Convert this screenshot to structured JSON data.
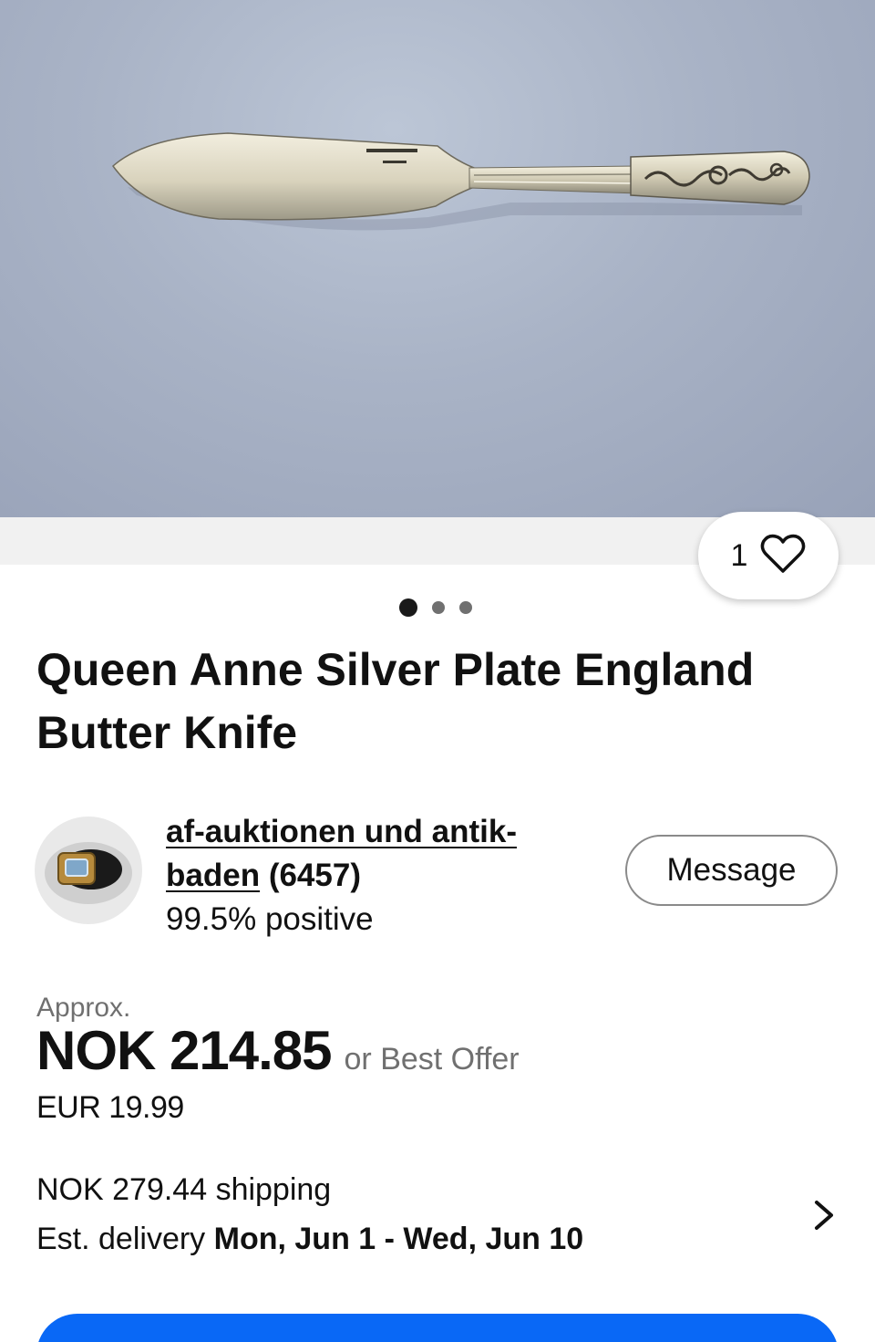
{
  "photo": {
    "subject": "butter-knife",
    "background_color": "#a9b3c6"
  },
  "watchers": {
    "count": "1",
    "icon": "heart-outline-icon"
  },
  "carousel": {
    "total": 3,
    "active_index": 0
  },
  "listing": {
    "title": "Queen Anne Silver Plate England Butter Knife"
  },
  "seller": {
    "name_link": "af-auktionen und antik-baden",
    "feedback_count": "(6457)",
    "feedback_percent": "99.5% positive",
    "message_label": "Message"
  },
  "price": {
    "approx_label": "Approx.",
    "amount": "NOK 214.85",
    "best_offer": "or Best Offer",
    "converted": "EUR 19.99"
  },
  "shipping": {
    "cost": "NOK 279.44 shipping",
    "delivery_prefix": "Est. delivery",
    "delivery_range": "Mon, Jun 1 - Wed, Jun 10"
  },
  "colors": {
    "primary_button": "#0968f6",
    "text": "#111111",
    "muted": "#707070"
  }
}
